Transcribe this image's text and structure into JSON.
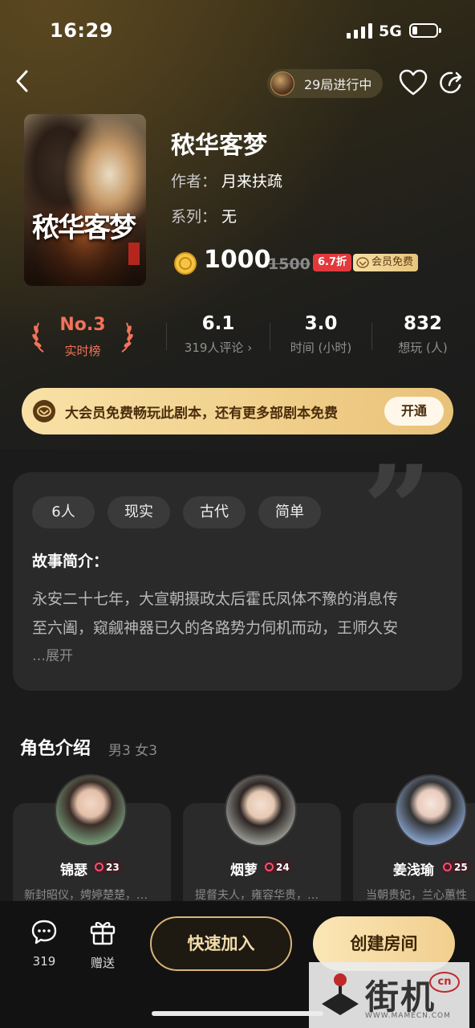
{
  "status_bar": {
    "time": "16:29",
    "network": "5G"
  },
  "header": {
    "sessions_text": "29局进行中"
  },
  "script": {
    "title": "秾华客梦",
    "cover_text": "秾华客梦",
    "author_label": "作者：",
    "author": "月来扶疏",
    "series_label": "系列：",
    "series": "无",
    "price": "1000",
    "original_price": "1500",
    "discount": "6.7折",
    "vip_free": "会员免费"
  },
  "stats": {
    "rank": "No.3",
    "rank_label": "实时榜",
    "rating": "6.1",
    "rating_label": "319人评论 ›",
    "duration": "3.0",
    "duration_label": "时间 (小时)",
    "want": "832",
    "want_label": "想玩 (人)"
  },
  "vip_banner": {
    "text": "大会员免费畅玩此剧本，还有更多部剧本免费",
    "button": "开通"
  },
  "story": {
    "tags": [
      "6人",
      "现实",
      "古代",
      "简单"
    ],
    "heading": "故事简介：",
    "line1": "永安二十七年，大宣朝摄政太后霍氏凤体不豫的消息传",
    "line2": "至六阖，窥觎神器已久的各路势力伺机而动，王师久安",
    "expand": "…展开"
  },
  "roles": {
    "heading": "角色介绍",
    "count": "男3 女3",
    "items": [
      {
        "name": "锦瑟",
        "badge": "23",
        "desc": "新封昭仪，娉婷楚楚，…"
      },
      {
        "name": "烟萝",
        "badge": "24",
        "desc": "提督夫人，雍容华贵，…"
      },
      {
        "name": "姜浅瑜",
        "badge": "25",
        "desc": "当朝贵妃，兰心蕙性"
      }
    ]
  },
  "bottom": {
    "comments": "319",
    "gift": "赠送",
    "quick_join": "快速加入",
    "create_room": "创建房间"
  },
  "watermark": {
    "text": "街机",
    "cn": "cn",
    "url": "WWW.MAMECN.COM"
  }
}
